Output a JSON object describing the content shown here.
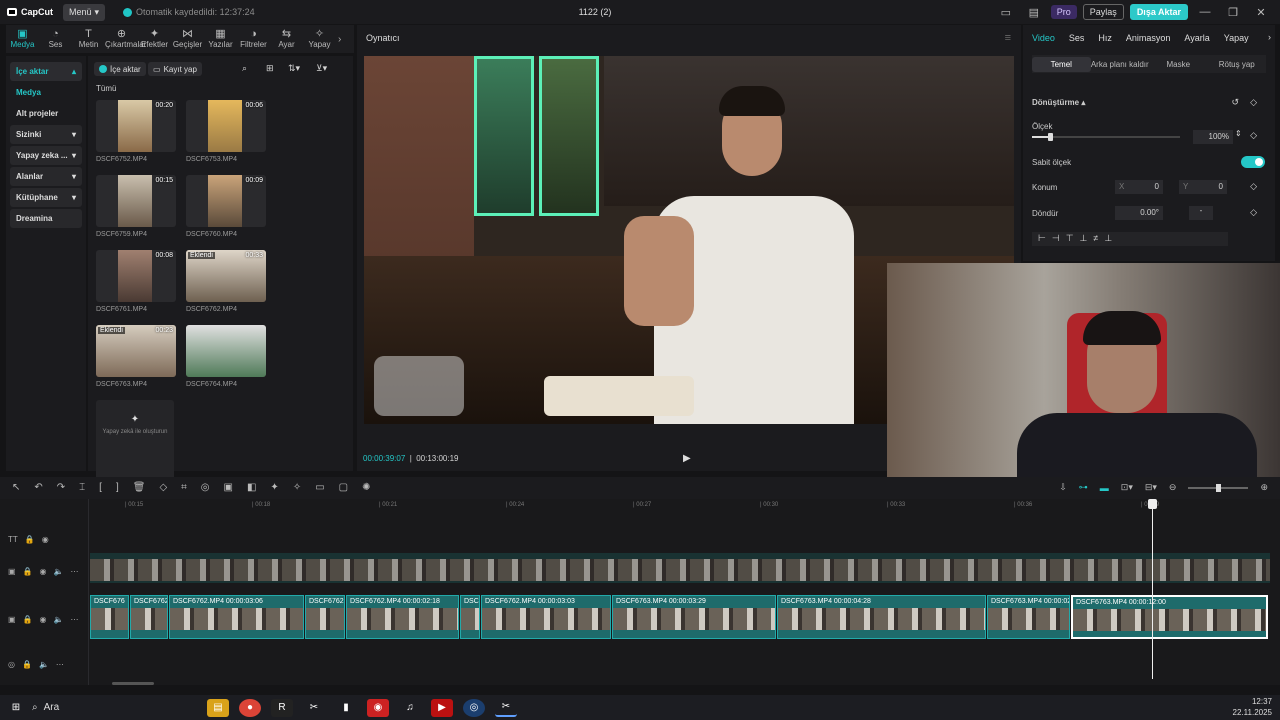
{
  "app": {
    "name": "CapCut",
    "menu_label": "Menü",
    "autosave": "Otomatik kaydedildi: 12:37:24",
    "project_title": "1122 (2)",
    "pro_label": "Pro",
    "share_label": "Paylaş",
    "export_label": "Dışa Aktar"
  },
  "tools": [
    {
      "label": "Medya",
      "icon": "media-icon"
    },
    {
      "label": "Ses",
      "icon": "audio-icon"
    },
    {
      "label": "Metin",
      "icon": "text-icon"
    },
    {
      "label": "Çıkartmalar",
      "icon": "sticker-icon"
    },
    {
      "label": "Efektler",
      "icon": "effects-icon"
    },
    {
      "label": "Geçişler",
      "icon": "transitions-icon"
    },
    {
      "label": "Yazılar",
      "icon": "captions-icon"
    },
    {
      "label": "Filtreler",
      "icon": "filters-icon"
    },
    {
      "label": "Ayar",
      "icon": "adjust-icon"
    },
    {
      "label": "Yapay",
      "icon": "ai-icon"
    }
  ],
  "leftnav": [
    {
      "label": "İçe aktar",
      "chev": "▴"
    },
    {
      "label": "Medya",
      "chev": ""
    },
    {
      "label": "Alt projeler",
      "chev": ""
    },
    {
      "label": "Sizinki",
      "chev": "▾"
    },
    {
      "label": "Yapay zeka ...",
      "chev": "▾"
    },
    {
      "label": "Alanlar",
      "chev": "▾"
    },
    {
      "label": "Kütüphane",
      "chev": "▾"
    },
    {
      "label": "Dreamina",
      "chev": ""
    }
  ],
  "media": {
    "import_label": "İçe aktar",
    "record_label": "Kayıt yap",
    "all_label": "Tümü",
    "ai_generate_label": "Yapay zekâ ile oluşturun",
    "items": [
      {
        "name": "DSCF6752.MP4",
        "duration": "00:20",
        "added": ""
      },
      {
        "name": "DSCF6753.MP4",
        "duration": "00:06",
        "added": ""
      },
      {
        "name": "DSCF6759.MP4",
        "duration": "00:15",
        "added": ""
      },
      {
        "name": "DSCF6760.MP4",
        "duration": "00:09",
        "added": ""
      },
      {
        "name": "DSCF6761.MP4",
        "duration": "00:08",
        "added": ""
      },
      {
        "name": "DSCF6762.MP4",
        "duration": "00:33",
        "added": "Eklendi"
      },
      {
        "name": "DSCF6763.MP4",
        "duration": "00:23",
        "added": "Eklendi"
      },
      {
        "name": "DSCF6764.MP4",
        "duration": "",
        "added": ""
      }
    ]
  },
  "player": {
    "header": "Oynatıcı",
    "current_time": "00:00:39:07",
    "total_time": "00:13:00:19"
  },
  "properties": {
    "tabs": [
      "Video",
      "Ses",
      "Hız",
      "Animasyon",
      "Ayarla",
      "Yapay"
    ],
    "subtabs": [
      "Temel",
      "Arka planı kaldır",
      "Maske",
      "Rötuş yap"
    ],
    "transform_label": "Dönüştürme",
    "scale_label": "Ölçek",
    "scale_value": "100%",
    "scale_level": 0.12,
    "uniform_label": "Sabit ölçek",
    "position_label": "Konum",
    "pos_x_label": "X",
    "pos_x": "0",
    "pos_y_label": "Y",
    "pos_y": "0",
    "rotate_label": "Döndür",
    "rotate_value": "0.00°",
    "rotate_extra": "-"
  },
  "ruler": [
    "00:15",
    "00:18",
    "00:21",
    "00:24",
    "00:27",
    "00:30",
    "00:33",
    "00:36",
    "00:39"
  ],
  "clips_main": [
    {
      "label": "DSCF676"
    },
    {
      "label": "DSCF6762"
    },
    {
      "label": "DSCF6762.MP4  00:00:03:06"
    },
    {
      "label": "DSCF6762.N"
    },
    {
      "label": "DSCF6762.MP4  00:00:02:18"
    },
    {
      "label": "DSCF"
    },
    {
      "label": "DSCF6762.MP4  00:00:03:03"
    },
    {
      "label": "DSCF6763.MP4  00:00:03:29"
    },
    {
      "label": "DSCF6763.MP4  00:00:04:28"
    },
    {
      "label": "DSCF6763.MP4  00:00:02"
    },
    {
      "label": "DSCF6763.MP4  00:00:12:00"
    }
  ],
  "taskbar": {
    "search_label": "Ara",
    "time": "12:37",
    "date": "22.11.2025"
  }
}
